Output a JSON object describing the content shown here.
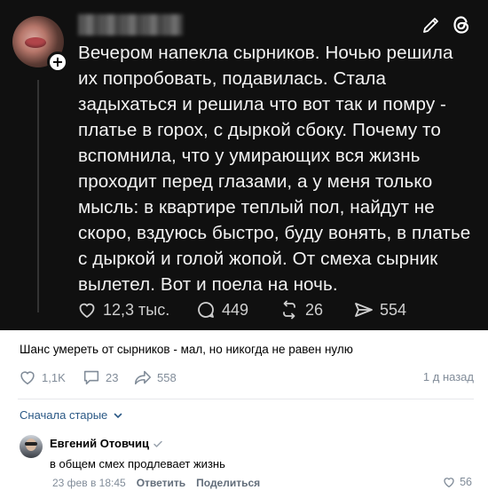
{
  "threads_post": {
    "post_text": "Вечером напекла сырников. Ночью решила их попробовать, подавилась. Стала задыхаться и решила что вот так и помру - платье в горох, с дыркой сбоку. Почему то вспомнила, что у умирающих вся жизнь проходит перед глазами, а у меня только мысль: в квартире теплый пол, найдут не скоро, вздуюсь быстро, буду вонять, в платье с дыркой и голой жопой. От смеха сырник вылетел. Вот и поела на ночь.",
    "follow_label": "+",
    "likes": "12,3 тыс.",
    "comments": "449",
    "reposts": "26",
    "shares": "554",
    "icons": [
      "edit-icon",
      "threads-logo-icon",
      "heart-icon",
      "comment-icon",
      "repost-icon",
      "send-icon"
    ]
  },
  "vk_post": {
    "caption": "Шанс умереть от сырников - мал, но никогда не равен нулю",
    "likes": "1,1K",
    "comments": "23",
    "shares": "558",
    "time": "1 д назад"
  },
  "comments_section": {
    "sort_label": "Сначала старые",
    "comment": {
      "author": "Евгений Отовчиц",
      "text": "в общем смех продлевает жизнь",
      "date": "23 фев в 18:45",
      "reply_label": "Ответить",
      "share_label": "Поделиться",
      "likes": "56"
    }
  },
  "colors": {
    "threads_bg": "#101010",
    "vk_link": "#2a5885",
    "vk_muted": "#818c99"
  }
}
